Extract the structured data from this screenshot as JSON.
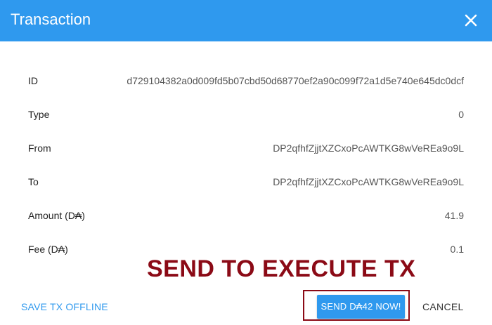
{
  "dialog": {
    "title": "Transaction",
    "close_icon": "close-icon"
  },
  "fields": {
    "id": {
      "label": "ID",
      "value": "d729104382a0d009fd5b07cbd50d68770ef2a90c099f72a1d5e740e645dc0dcf"
    },
    "type": {
      "label": "Type",
      "value": "0"
    },
    "from": {
      "label": "From",
      "value": "DP2qfhfZjjtXZCxoPcAWTKG8wVeREa9o9L"
    },
    "to": {
      "label": "To",
      "value": "DP2qfhfZjjtXZCxoPcAWTKG8wVeREa9o9L"
    },
    "amount": {
      "label": "Amount (D₳)",
      "value": "41.9"
    },
    "fee": {
      "label": "Fee (D₳)",
      "value": "0.1"
    }
  },
  "annotation": {
    "text": "SEND TO EXECUTE TX"
  },
  "actions": {
    "save_offline_label": "SAVE TX OFFLINE",
    "send_label": "SEND D₳42 NOW!",
    "cancel_label": "CANCEL"
  },
  "colors": {
    "accent": "#2f99ee",
    "annotation": "#8b0a16"
  }
}
